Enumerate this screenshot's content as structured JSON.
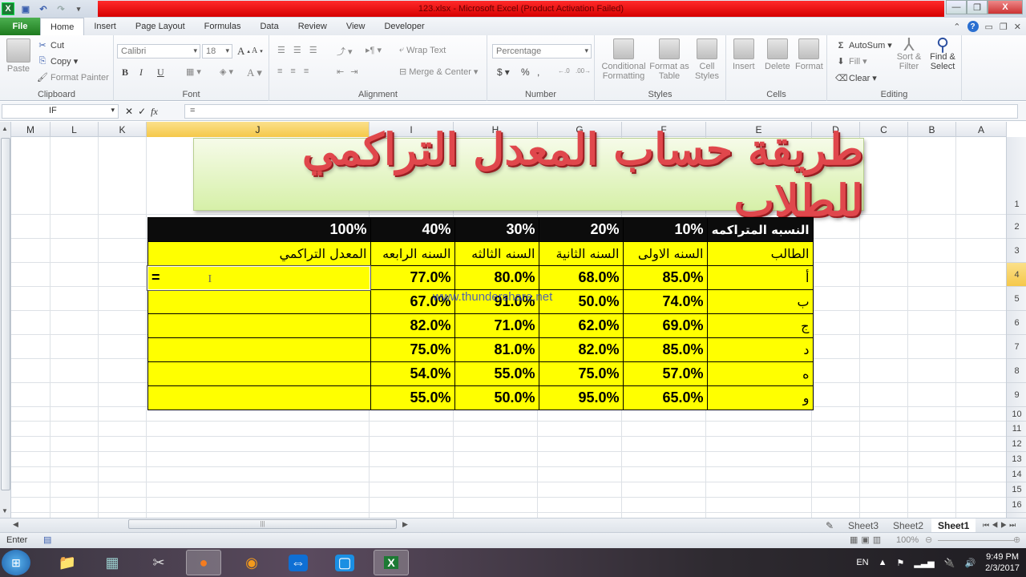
{
  "window": {
    "title": "123.xlsx  -  Microsoft Excel (Product Activation Failed)",
    "controls": {
      "minimize": "—",
      "restore": "❐",
      "close": "X"
    }
  },
  "quick_access": {
    "icons": [
      "excel-logo-icon",
      "save-icon",
      "undo-icon",
      "redo-icon",
      "customize-icon"
    ]
  },
  "ribbon_tabs": [
    "File",
    "Home",
    "Insert",
    "Page Layout",
    "Formulas",
    "Data",
    "Review",
    "View",
    "Developer"
  ],
  "active_tab": "Home",
  "ribbon": {
    "clipboard": {
      "label": "Clipboard",
      "paste": "Paste",
      "cut": "Cut",
      "copy": "Copy",
      "format_painter": "Format Painter"
    },
    "font": {
      "label": "Font",
      "font_name": "Calibri",
      "font_size": "18",
      "bold": "B",
      "italic": "I",
      "underline": "U"
    },
    "alignment": {
      "label": "Alignment",
      "wrap_text": "Wrap Text",
      "merge_center": "Merge & Center"
    },
    "number": {
      "label": "Number",
      "format": "Percentage",
      "currency": "$",
      "percent": "%",
      "comma": ",",
      "inc_decimal": "←.0",
      "dec_decimal": ".00→"
    },
    "styles": {
      "label": "Styles",
      "conditional_formatting": "Conditional Formatting",
      "format_as_table": "Format as Table",
      "cell_styles": "Cell Styles"
    },
    "cells": {
      "label": "Cells",
      "insert": "Insert",
      "delete": "Delete",
      "format": "Format"
    },
    "editing": {
      "label": "Editing",
      "autosum": "AutoSum",
      "fill": "Fill",
      "clear": "Clear",
      "sort_filter": "Sort & Filter",
      "find_select": "Find & Select"
    }
  },
  "formula_bar": {
    "name_box": "IF",
    "formula": "=",
    "cancel": "✕",
    "enter": "✓",
    "fx": "fx"
  },
  "columns": [
    "M",
    "L",
    "K",
    "J",
    "I",
    "H",
    "G",
    "F",
    "E",
    "D",
    "C",
    "B",
    "A"
  ],
  "selected_column": "J",
  "rows": [
    "1",
    "2",
    "3",
    "4",
    "5",
    "6",
    "7",
    "8",
    "9",
    "10",
    "11",
    "12",
    "13",
    "14",
    "15",
    "16"
  ],
  "selected_row": "4",
  "banner_title": "طريقة حساب المعدل التراكمي للطلاب",
  "table": {
    "weights_row": {
      "label": "النسبه المتراكمه",
      "year1": "10%",
      "year2": "20%",
      "year3": "30%",
      "year4": "40%",
      "total": "100%"
    },
    "header_row": {
      "student": "الطالب",
      "year1": "السنه الاولى",
      "year2": "السنه الثانية",
      "year3": "السنه الثالثه",
      "year4": "السنه الرابعه",
      "gpa": "المعدل التراكمي"
    },
    "students": [
      {
        "name": "أ",
        "year1": "85.0%",
        "year2": "68.0%",
        "year3": "80.0%",
        "year4": "77.0%",
        "gpa": "="
      },
      {
        "name": "ب",
        "year1": "74.0%",
        "year2": "50.0%",
        "year3": "91.0%",
        "year4": "67.0%",
        "gpa": ""
      },
      {
        "name": "ج",
        "year1": "69.0%",
        "year2": "62.0%",
        "year3": "71.0%",
        "year4": "82.0%",
        "gpa": ""
      },
      {
        "name": "د",
        "year1": "85.0%",
        "year2": "82.0%",
        "year3": "81.0%",
        "year4": "75.0%",
        "gpa": ""
      },
      {
        "name": "ه",
        "year1": "57.0%",
        "year2": "75.0%",
        "year3": "55.0%",
        "year4": "54.0%",
        "gpa": ""
      },
      {
        "name": "و",
        "year1": "65.0%",
        "year2": "95.0%",
        "year3": "50.0%",
        "year4": "55.0%",
        "gpa": ""
      }
    ]
  },
  "watermark": "www.thundershare.net",
  "sheets": [
    "Sheet3",
    "Sheet2",
    "Sheet1"
  ],
  "active_sheet": "Sheet1",
  "status": {
    "mode": "Enter",
    "zoom": "100%"
  },
  "taskbar": {
    "apps": [
      "start-orb",
      "file-explorer",
      "calculator",
      "snipping-tool",
      "firefox",
      "media-player",
      "teamviewer",
      "screen-capture",
      "excel"
    ],
    "language": "EN",
    "time": "9:49 PM",
    "date": "2/3/2017"
  },
  "colors": {
    "header_black": "#0c0c0c",
    "cell_yellow": "#ffff00",
    "banner_text": "#e0474c",
    "titlebar_red": "#e00000",
    "file_tab_green": "#2e8b2e"
  }
}
